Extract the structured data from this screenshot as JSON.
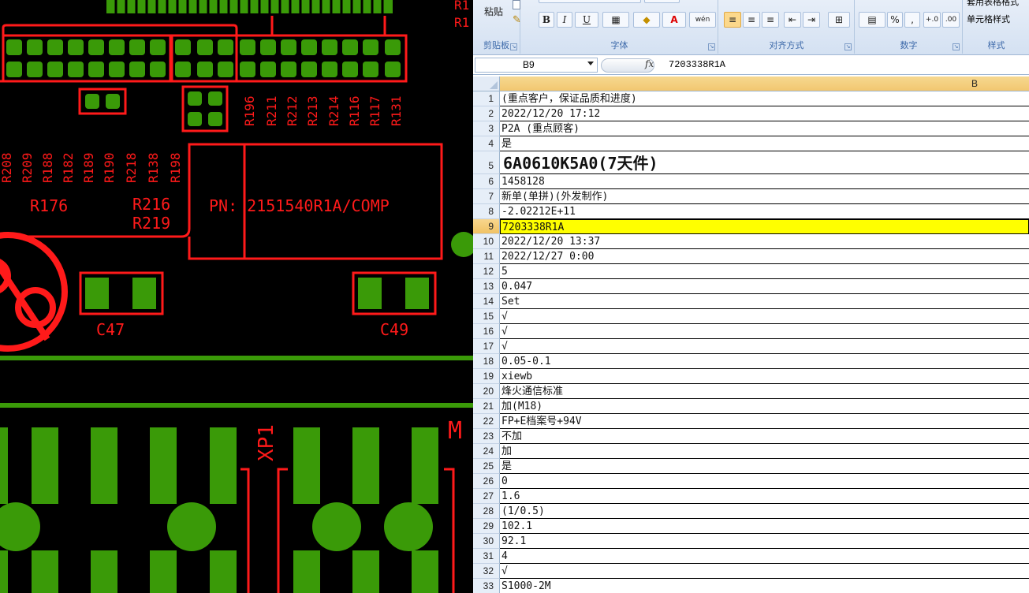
{
  "pcb": {
    "labels": {
      "top_right": [
        "R1",
        "R1"
      ],
      "vertical_row_a": [
        "R196",
        "R211",
        "R212",
        "R213",
        "R214",
        "R116",
        "R117",
        "R131"
      ],
      "vertical_row_b": [
        "R208",
        "R209",
        "R188",
        "R182",
        "R189",
        "R190",
        "R218",
        "R138",
        "R198"
      ],
      "r176": "R176",
      "r216": "R216",
      "r219": "R219",
      "pn": "PN: 2151540R1A/COMP",
      "c47": "C47",
      "c49": "C49",
      "xp1": "XP1",
      "m": "M"
    },
    "colors": {
      "copper": "#3a9a08",
      "silk": "#ff1a1a",
      "background": "#000000"
    }
  },
  "excel": {
    "ribbon": {
      "paste_label": "粘贴",
      "groups": [
        "剪贴板",
        "字体",
        "对齐方式",
        "数字",
        "样式"
      ],
      "font_buttons": [
        "B",
        "I",
        "U"
      ],
      "number_buttons": [
        "%",
        ","
      ],
      "style_items": [
        "套用表格格式",
        "单元格样式"
      ],
      "top_right_labels": [
        "R1",
        "R1"
      ]
    },
    "formula_bar": {
      "cell_ref": "B9",
      "fx": "fx",
      "value": "7203338R1A"
    },
    "column_header": "B",
    "rows": [
      {
        "n": "1",
        "v": "(重点客户，保证品质和进度)"
      },
      {
        "n": "2",
        "v": "2022/12/20 17:12"
      },
      {
        "n": "3",
        "v": "P2A (重点顾客)"
      },
      {
        "n": "4",
        "v": "是"
      },
      {
        "n": "5",
        "v": "6A0610K5A0(7天件)"
      },
      {
        "n": "6",
        "v": "1458128"
      },
      {
        "n": "7",
        "v": "新单(单拼)(外发制作)"
      },
      {
        "n": "8",
        "v": "-2.02212E+11"
      },
      {
        "n": "9",
        "v": "7203338R1A"
      },
      {
        "n": "10",
        "v": "2022/12/20 13:37"
      },
      {
        "n": "11",
        "v": "2022/12/27 0:00"
      },
      {
        "n": "12",
        "v": "5"
      },
      {
        "n": "13",
        "v": "0.047"
      },
      {
        "n": "14",
        "v": "Set"
      },
      {
        "n": "15",
        "v": "√"
      },
      {
        "n": "16",
        "v": "√"
      },
      {
        "n": "17",
        "v": "√"
      },
      {
        "n": "18",
        "v": "0.05-0.1"
      },
      {
        "n": "19",
        "v": "xiewb"
      },
      {
        "n": "20",
        "v": "烽火通信标准"
      },
      {
        "n": "21",
        "v": "加(M18)"
      },
      {
        "n": "22",
        "v": "FP+E档案号+94V"
      },
      {
        "n": "23",
        "v": "不加"
      },
      {
        "n": "24",
        "v": "加"
      },
      {
        "n": "25",
        "v": "是"
      },
      {
        "n": "26",
        "v": "0"
      },
      {
        "n": "27",
        "v": "1.6"
      },
      {
        "n": "28",
        "v": "(1/0.5)"
      },
      {
        "n": "29",
        "v": "102.1"
      },
      {
        "n": "30",
        "v": "92.1"
      },
      {
        "n": "31",
        "v": "4"
      },
      {
        "n": "32",
        "v": "√"
      },
      {
        "n": "33",
        "v": "S1000-2M"
      }
    ],
    "selected_row": "9",
    "colors": {
      "selection": "#ffff00",
      "header_highlight": "#f2c770"
    }
  }
}
